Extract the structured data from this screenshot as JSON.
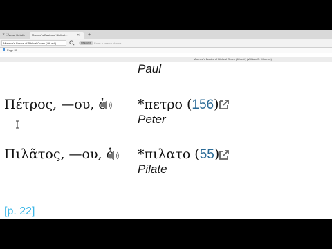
{
  "browser": {
    "tabs": [
      {
        "label": "Verse Details"
      },
      {
        "label": "Mounce's Basics of Biblical..."
      }
    ],
    "new_tab": "+"
  },
  "toolbar": {
    "resource": "Mounce's Basics of Biblical Greek (4th ed.)",
    "search_scope": "Resource",
    "search_placeholder": "Enter a search phrase"
  },
  "pagebar": {
    "label": "Page 37"
  },
  "banner": {
    "title": "Mounce's Basics of Biblical Greek (4th ed.) (William D. Mounce)"
  },
  "entries": [
    {
      "gloss": "Paul"
    },
    {
      "lemma": "Πέτρος, —ου, ὁ",
      "root": "*πετρο",
      "freq": "156",
      "gloss": "Peter"
    },
    {
      "lemma": "Πιλᾶτος, —ου, ὁ",
      "root": "*πιλατο",
      "freq": "55",
      "gloss": "Pilate"
    }
  ],
  "page_ref": "[p. 22]",
  "icons": {
    "speaker": "speaker-icon",
    "link": "external-link-icon",
    "cursor": "text-cursor-icon"
  }
}
